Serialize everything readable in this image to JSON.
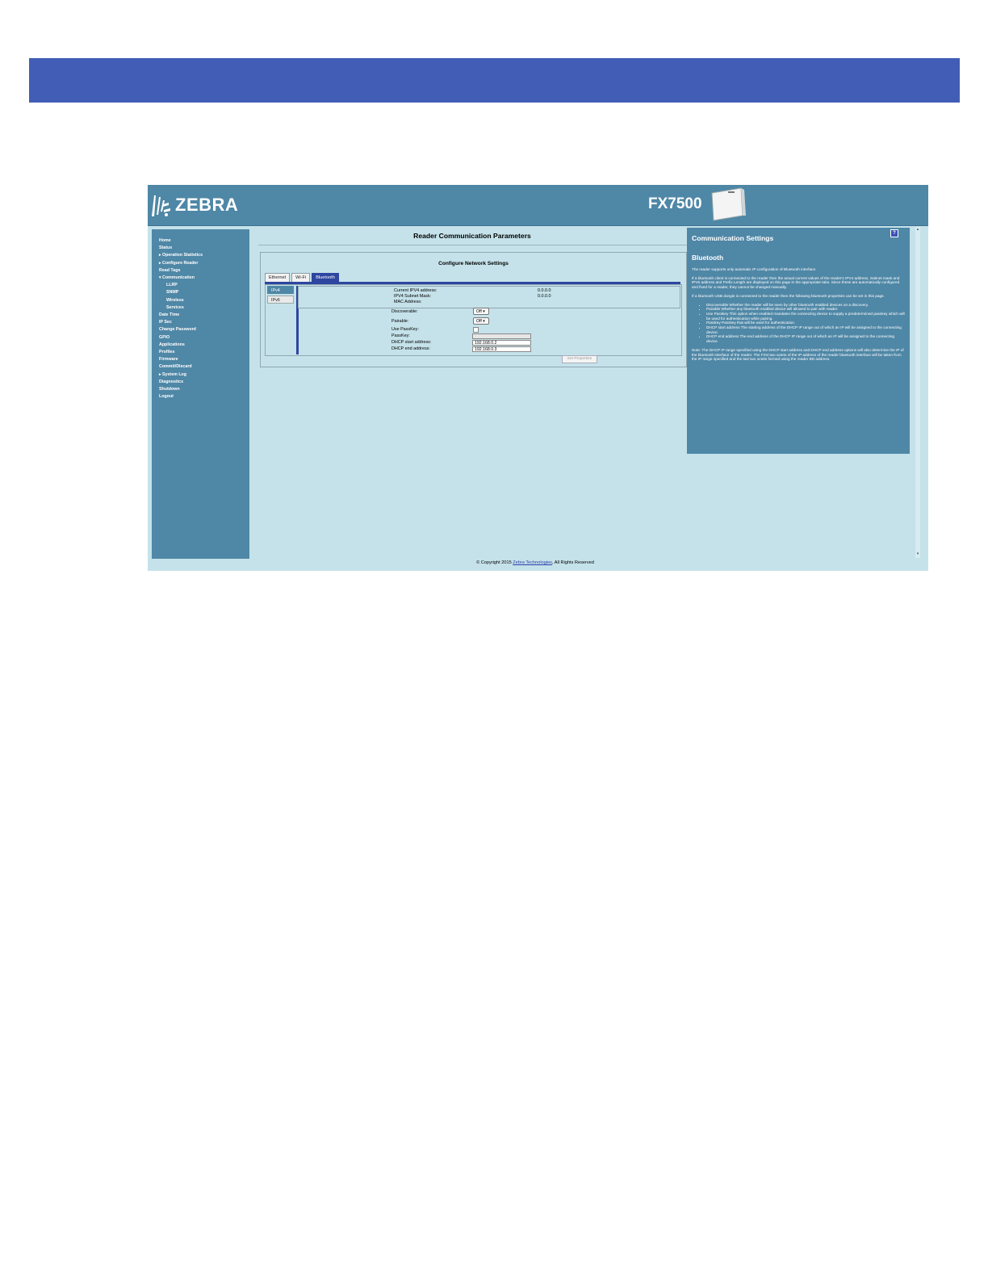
{
  "header": {
    "brand": "ZEBRA",
    "model": "FX7500"
  },
  "nav": {
    "items": [
      {
        "label": "Home",
        "caret": ""
      },
      {
        "label": "Status",
        "caret": ""
      },
      {
        "label": "Operation Statistics",
        "caret": "▸"
      },
      {
        "label": "Configure Reader",
        "caret": "▸"
      },
      {
        "label": "Read Tags",
        "caret": ""
      },
      {
        "label": "Communication",
        "caret": "▾"
      },
      {
        "label": "LLRP",
        "caret": ""
      },
      {
        "label": "SNMP",
        "caret": ""
      },
      {
        "label": "Wireless",
        "caret": ""
      },
      {
        "label": "Services",
        "caret": ""
      },
      {
        "label": "Date Time",
        "caret": ""
      },
      {
        "label": "IP Sec",
        "caret": ""
      },
      {
        "label": "Change Password",
        "caret": ""
      },
      {
        "label": "GPIO",
        "caret": ""
      },
      {
        "label": "Applications",
        "caret": ""
      },
      {
        "label": "Profiles",
        "caret": ""
      },
      {
        "label": "Firmware",
        "caret": ""
      },
      {
        "label": "Commit/Discard",
        "caret": ""
      },
      {
        "label": "System Log",
        "caret": "▸"
      },
      {
        "label": "Diagnostics",
        "caret": ""
      },
      {
        "label": "Shutdown",
        "caret": ""
      },
      {
        "label": "Logout",
        "caret": ""
      }
    ]
  },
  "main": {
    "title": "Reader Communication Parameters",
    "panel_title": "Configure Network Settings",
    "tabs": [
      "Ethernet",
      "Wi-Fi",
      "Bluetooth"
    ],
    "active_tab": "Bluetooth",
    "ip_tabs": [
      "IPv4",
      "IPv6"
    ],
    "status": {
      "current_ipv4_label": "Current IPV4 address:",
      "current_ipv4_value": "0.0.0.0",
      "subnet_label": "IPV4 Subnet Mask:",
      "subnet_value": "0.0.0.0",
      "mac_label": "MAC Address:",
      "mac_value": ""
    },
    "fields": {
      "discoverable_label": "Discoverable:",
      "discoverable_value": "Off ▾",
      "pairable_label": "Pairable:",
      "pairable_value": "Off ▾",
      "use_passkey_label": "Use PassKey:",
      "passkey_label": "PassKey:",
      "passkey_value": "",
      "dhcp_start_label": "DHCP start address:",
      "dhcp_start_value": "192.168.0.2",
      "dhcp_end_label": "DHCP end address:",
      "dhcp_end_value": "192.168.0.3"
    },
    "set_button": "Set Properties"
  },
  "help": {
    "title": "Communication Settings",
    "q": "?",
    "subtitle": "Bluetooth",
    "p1": "The reader supports only automatic IP configuration of Bluetooth interface.",
    "p2": "If a bluetooth client is connected to the reader then the actual current values of the reader's IPV4 address, Subnet mask and IPV6 address and Prefix Length are displayed on this page in the appropriate tabs. Since these are automatically configured and fixed for a reader, they cannot be changed manually.",
    "p3": "If a bluetooth USB dongle is connected to the reader then the following bluetooth properties can be set in this page.",
    "bullets": [
      "Discoverable Whether the reader will be seen by other bluetooth enabled devices on a discovery.",
      "Pairable Whether any bluetooth enabled device will allowed to pair with reader.",
      "Use Passkey This option when enabled mandates the connecting device to supply a predetermined passkey which will be used for authentication while pairing.",
      "Passkey Passkey that will be used for authentication.",
      "DHCP start address The starting address of the DHCP IP range out of which an IP will be assigned to the connecting device.",
      "DHCP end address The end address of the DHCP IP range out of which an IP will be assigned to the connecting device."
    ],
    "note": "Note: The DHCP IP range specified using the DHCP start address and DHCP end address options will also determine the IP of the bluetooth interface of the reader. The First two octets of the IP address of the reader bluetooth interface will be taken from the IP range specified and the last two octets formed using the reader BD address."
  },
  "footer": {
    "prefix": "© Copyright 2015 ",
    "link": "Zebra Technologies",
    "suffix": ", All Rights Reserved"
  },
  "colors": {
    "banner": "#425db5",
    "header": "#4f87a6",
    "content_bg": "#c5e2ea",
    "active_tab": "#2e46a0"
  }
}
